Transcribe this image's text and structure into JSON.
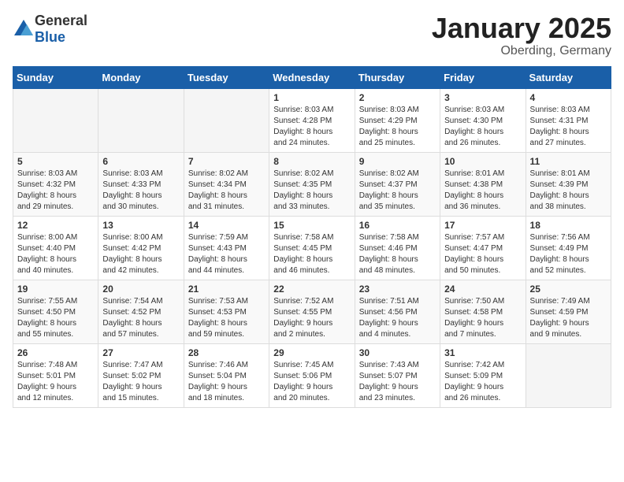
{
  "header": {
    "logo_general": "General",
    "logo_blue": "Blue",
    "month_year": "January 2025",
    "location": "Oberding, Germany"
  },
  "weekdays": [
    "Sunday",
    "Monday",
    "Tuesday",
    "Wednesday",
    "Thursday",
    "Friday",
    "Saturday"
  ],
  "weeks": [
    [
      {
        "day": "",
        "content": ""
      },
      {
        "day": "",
        "content": ""
      },
      {
        "day": "",
        "content": ""
      },
      {
        "day": "1",
        "content": "Sunrise: 8:03 AM\nSunset: 4:28 PM\nDaylight: 8 hours\nand 24 minutes."
      },
      {
        "day": "2",
        "content": "Sunrise: 8:03 AM\nSunset: 4:29 PM\nDaylight: 8 hours\nand 25 minutes."
      },
      {
        "day": "3",
        "content": "Sunrise: 8:03 AM\nSunset: 4:30 PM\nDaylight: 8 hours\nand 26 minutes."
      },
      {
        "day": "4",
        "content": "Sunrise: 8:03 AM\nSunset: 4:31 PM\nDaylight: 8 hours\nand 27 minutes."
      }
    ],
    [
      {
        "day": "5",
        "content": "Sunrise: 8:03 AM\nSunset: 4:32 PM\nDaylight: 8 hours\nand 29 minutes."
      },
      {
        "day": "6",
        "content": "Sunrise: 8:03 AM\nSunset: 4:33 PM\nDaylight: 8 hours\nand 30 minutes."
      },
      {
        "day": "7",
        "content": "Sunrise: 8:02 AM\nSunset: 4:34 PM\nDaylight: 8 hours\nand 31 minutes."
      },
      {
        "day": "8",
        "content": "Sunrise: 8:02 AM\nSunset: 4:35 PM\nDaylight: 8 hours\nand 33 minutes."
      },
      {
        "day": "9",
        "content": "Sunrise: 8:02 AM\nSunset: 4:37 PM\nDaylight: 8 hours\nand 35 minutes."
      },
      {
        "day": "10",
        "content": "Sunrise: 8:01 AM\nSunset: 4:38 PM\nDaylight: 8 hours\nand 36 minutes."
      },
      {
        "day": "11",
        "content": "Sunrise: 8:01 AM\nSunset: 4:39 PM\nDaylight: 8 hours\nand 38 minutes."
      }
    ],
    [
      {
        "day": "12",
        "content": "Sunrise: 8:00 AM\nSunset: 4:40 PM\nDaylight: 8 hours\nand 40 minutes."
      },
      {
        "day": "13",
        "content": "Sunrise: 8:00 AM\nSunset: 4:42 PM\nDaylight: 8 hours\nand 42 minutes."
      },
      {
        "day": "14",
        "content": "Sunrise: 7:59 AM\nSunset: 4:43 PM\nDaylight: 8 hours\nand 44 minutes."
      },
      {
        "day": "15",
        "content": "Sunrise: 7:58 AM\nSunset: 4:45 PM\nDaylight: 8 hours\nand 46 minutes."
      },
      {
        "day": "16",
        "content": "Sunrise: 7:58 AM\nSunset: 4:46 PM\nDaylight: 8 hours\nand 48 minutes."
      },
      {
        "day": "17",
        "content": "Sunrise: 7:57 AM\nSunset: 4:47 PM\nDaylight: 8 hours\nand 50 minutes."
      },
      {
        "day": "18",
        "content": "Sunrise: 7:56 AM\nSunset: 4:49 PM\nDaylight: 8 hours\nand 52 minutes."
      }
    ],
    [
      {
        "day": "19",
        "content": "Sunrise: 7:55 AM\nSunset: 4:50 PM\nDaylight: 8 hours\nand 55 minutes."
      },
      {
        "day": "20",
        "content": "Sunrise: 7:54 AM\nSunset: 4:52 PM\nDaylight: 8 hours\nand 57 minutes."
      },
      {
        "day": "21",
        "content": "Sunrise: 7:53 AM\nSunset: 4:53 PM\nDaylight: 8 hours\nand 59 minutes."
      },
      {
        "day": "22",
        "content": "Sunrise: 7:52 AM\nSunset: 4:55 PM\nDaylight: 9 hours\nand 2 minutes."
      },
      {
        "day": "23",
        "content": "Sunrise: 7:51 AM\nSunset: 4:56 PM\nDaylight: 9 hours\nand 4 minutes."
      },
      {
        "day": "24",
        "content": "Sunrise: 7:50 AM\nSunset: 4:58 PM\nDaylight: 9 hours\nand 7 minutes."
      },
      {
        "day": "25",
        "content": "Sunrise: 7:49 AM\nSunset: 4:59 PM\nDaylight: 9 hours\nand 9 minutes."
      }
    ],
    [
      {
        "day": "26",
        "content": "Sunrise: 7:48 AM\nSunset: 5:01 PM\nDaylight: 9 hours\nand 12 minutes."
      },
      {
        "day": "27",
        "content": "Sunrise: 7:47 AM\nSunset: 5:02 PM\nDaylight: 9 hours\nand 15 minutes."
      },
      {
        "day": "28",
        "content": "Sunrise: 7:46 AM\nSunset: 5:04 PM\nDaylight: 9 hours\nand 18 minutes."
      },
      {
        "day": "29",
        "content": "Sunrise: 7:45 AM\nSunset: 5:06 PM\nDaylight: 9 hours\nand 20 minutes."
      },
      {
        "day": "30",
        "content": "Sunrise: 7:43 AM\nSunset: 5:07 PM\nDaylight: 9 hours\nand 23 minutes."
      },
      {
        "day": "31",
        "content": "Sunrise: 7:42 AM\nSunset: 5:09 PM\nDaylight: 9 hours\nand 26 minutes."
      },
      {
        "day": "",
        "content": ""
      }
    ]
  ]
}
